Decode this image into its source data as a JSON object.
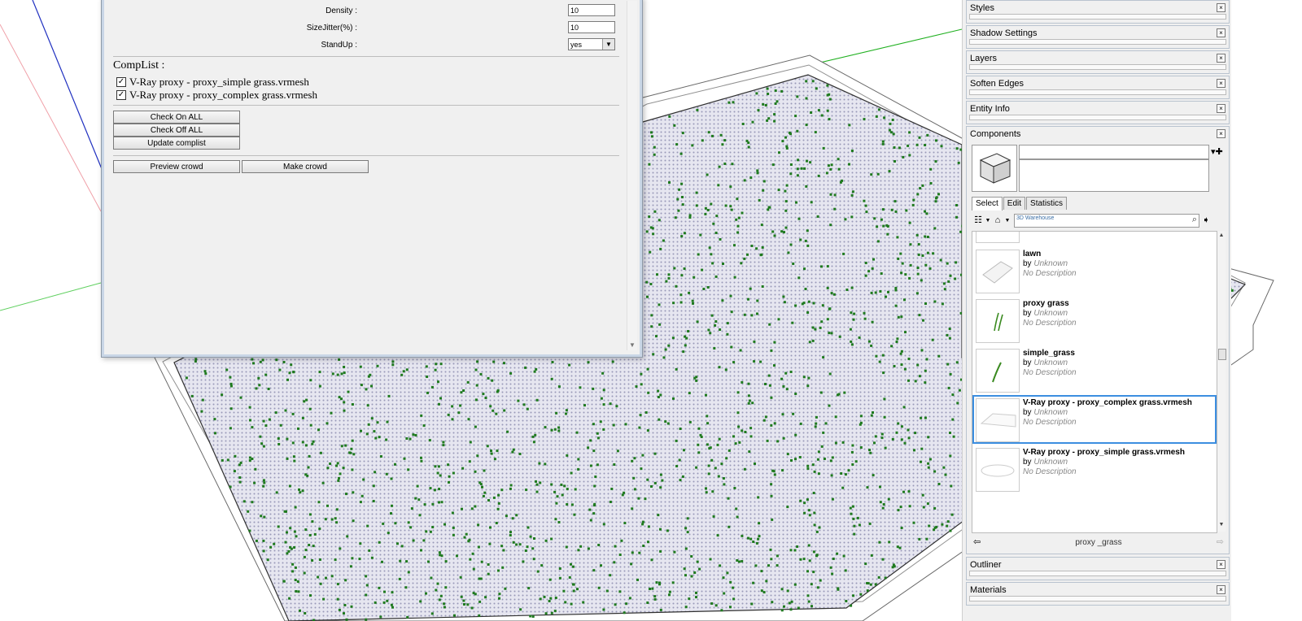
{
  "dialog": {
    "params": [
      {
        "label": "Density :",
        "value": "10"
      },
      {
        "label": "SizeJitter(%) :",
        "value": "10"
      },
      {
        "label": "StandUp :",
        "value": "yes"
      }
    ],
    "complist_title": "CompList :",
    "components": [
      {
        "label": "V-Ray proxy - proxy_simple grass.vrmesh",
        "checked": true
      },
      {
        "label": "V-Ray proxy - proxy_complex grass.vrmesh",
        "checked": true
      }
    ],
    "buttons": {
      "check_on_all": "Check On ALL",
      "check_off_all": "Check Off ALL",
      "update_complist": "Update complist",
      "preview_crowd": "Preview crowd",
      "make_crowd": "Make crowd"
    }
  },
  "tray": {
    "panels": [
      "Styles",
      "Shadow Settings",
      "Layers",
      "Soften Edges",
      "Entity Info"
    ],
    "components_title": "Components",
    "tabs": [
      "Select",
      "Edit",
      "Statistics"
    ],
    "active_tab": "Select",
    "warehouse_label": "3D Warehouse",
    "items": [
      {
        "name": "lawn",
        "by": "by",
        "author": "Unknown",
        "desc": "No Description"
      },
      {
        "name": "proxy grass",
        "by": "by",
        "author": "Unknown",
        "desc": "No Description"
      },
      {
        "name": "simple_grass",
        "by": "by",
        "author": "Unknown",
        "desc": "No Description"
      },
      {
        "name": "V-Ray proxy - proxy_complex grass.vrmesh",
        "by": "by",
        "author": "Unknown",
        "desc": "No Description",
        "selected": true
      },
      {
        "name": "V-Ray proxy - proxy_simple grass.vrmesh",
        "by": "by",
        "author": "Unknown",
        "desc": "No Description"
      }
    ],
    "location": "proxy _grass",
    "bottom_panels": [
      "Outliner",
      "Materials"
    ]
  },
  "colors": {
    "accent_selection": "#3c8ee0",
    "grass_dot": "#1f7a1f",
    "axis_red": "#d02020",
    "axis_green": "#20b020",
    "axis_blue": "#2030c0"
  }
}
